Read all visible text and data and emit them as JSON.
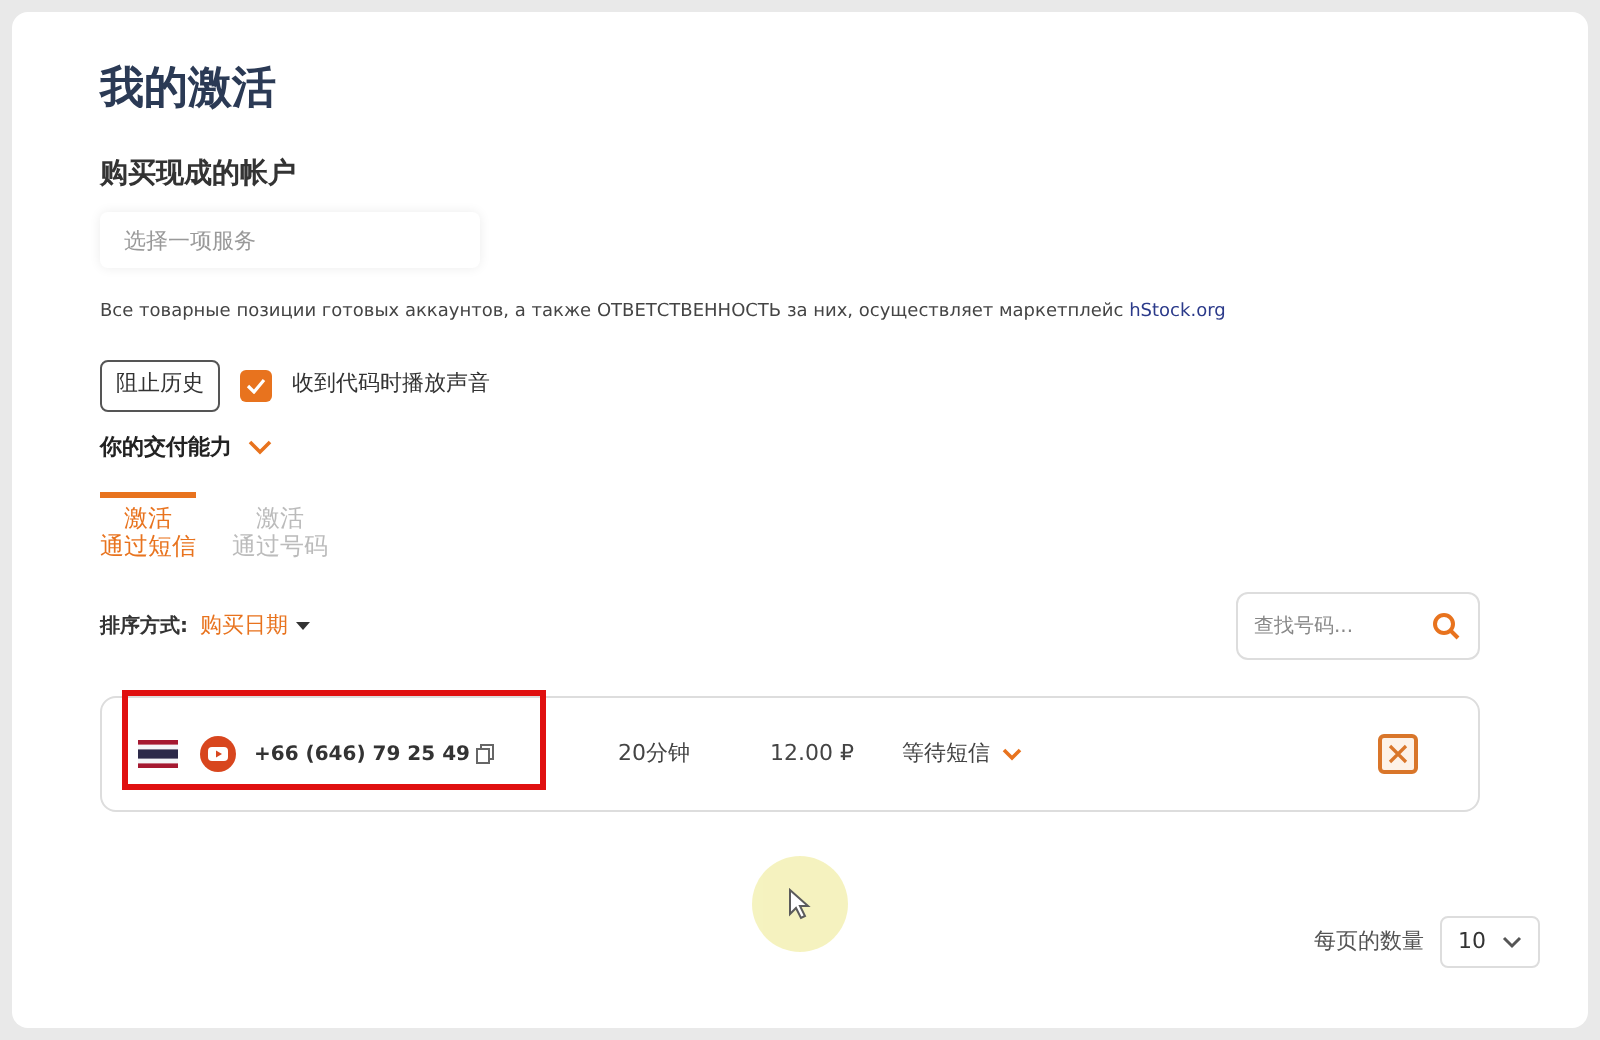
{
  "title": "我的激活",
  "buy_section": {
    "heading": "购买现成的帐户",
    "service_select": {
      "placeholder": "选择一项服务"
    },
    "notice": "Все товарные позиции готовых аккаунтов, а также ОТВЕТСТВЕННОСТЬ за них, осуществляет маркетплейс",
    "notice_link": "hStock.org"
  },
  "block_history_button": "阻止历史",
  "sound_checkbox": {
    "label": "收到代码时播放声音",
    "checked": true
  },
  "capabilities": {
    "label": "你的交付能力",
    "expanded": false
  },
  "tabs": [
    {
      "line1": "激活",
      "line2": "通过短信",
      "selected": true
    },
    {
      "line1": "激活",
      "line2": "通过号码",
      "selected": false
    }
  ],
  "sort": {
    "label": "排序方式:",
    "value": "购买日期"
  },
  "search": {
    "placeholder": "查找号码..."
  },
  "activations": [
    {
      "phone": "+66 (646) 79 25 49",
      "time": "20分钟",
      "price": "12.00 ₽",
      "status": "等待短信",
      "highlighted": true
    }
  ],
  "pagination": {
    "label": "每页的数量",
    "value": "10"
  }
}
